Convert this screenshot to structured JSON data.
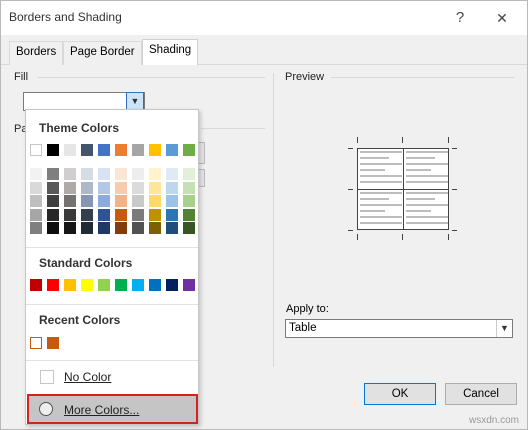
{
  "window": {
    "title": "Borders and Shading",
    "help": "?",
    "close": "✕"
  },
  "tabs": [
    {
      "label": "Borders"
    },
    {
      "label": "Page Border"
    },
    {
      "label": "Shading"
    }
  ],
  "shading": {
    "fill_label": "Fill",
    "pattern_label_partial": "Pa",
    "preview_label": "Preview",
    "apply_to_label": "Apply to:",
    "apply_to_value": "Table"
  },
  "buttons": {
    "ok": "OK",
    "cancel": "Cancel"
  },
  "color_menu": {
    "theme_colors_label": "Theme Colors",
    "standard_colors_label": "Standard Colors",
    "recent_colors_label": "Recent Colors",
    "no_color_label": "No Color",
    "more_colors_label": "More Colors...",
    "theme_base_row": [
      "#ffffff",
      "#000000",
      "#e7e6e6",
      "#44546a",
      "#4472c4",
      "#ed7d31",
      "#a5a5a5",
      "#ffc000",
      "#5b9bd5",
      "#70ad47"
    ],
    "theme_shade_columns": [
      [
        "#f2f2f2",
        "#d9d9d9",
        "#bfbfbf",
        "#a6a6a6",
        "#7f7f7f"
      ],
      [
        "#7f7f7f",
        "#595959",
        "#404040",
        "#262626",
        "#0d0d0d"
      ],
      [
        "#d0cece",
        "#aeaaaa",
        "#757171",
        "#3a3838",
        "#171616"
      ],
      [
        "#d6dce4",
        "#adb9ca",
        "#8496b0",
        "#333f4f",
        "#222a35"
      ],
      [
        "#d9e2f3",
        "#b4c6e7",
        "#8eaadb",
        "#2f5496",
        "#1f3864"
      ],
      [
        "#fbe5d5",
        "#f7cbac",
        "#f4b183",
        "#c55a11",
        "#833c0b"
      ],
      [
        "#ededed",
        "#dbdbdb",
        "#c9c9c9",
        "#7b7b7b",
        "#525252"
      ],
      [
        "#fff2cc",
        "#fee599",
        "#ffd965",
        "#bf9000",
        "#7f6000"
      ],
      [
        "#deebf6",
        "#bdd7ee",
        "#9cc3e5",
        "#2e75b5",
        "#1e4e79"
      ],
      [
        "#e2efd9",
        "#c5e0b3",
        "#a8d08d",
        "#538135",
        "#375623"
      ]
    ],
    "standard_colors": [
      "#c00000",
      "#ff0000",
      "#ffc000",
      "#ffff00",
      "#92d050",
      "#00b050",
      "#00b0f0",
      "#0070c0",
      "#002060",
      "#7030a0"
    ],
    "recent_colors": [
      "#ffffff",
      "#c55a11"
    ]
  },
  "watermark": "wsxdn.com"
}
